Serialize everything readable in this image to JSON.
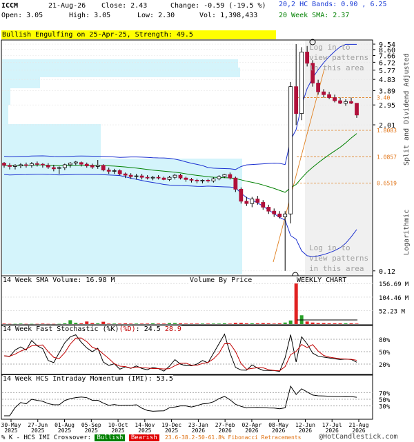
{
  "header": {
    "ticker": "ICCM",
    "date": "21-Aug-26",
    "close": "Close: 2.43",
    "change": "Change: -0.59 (-19.5 %)",
    "open": "Open: 3.05",
    "high": "High: 3.05",
    "low": "Low: 2.30",
    "vol": "Vol: 1,398,433",
    "bands": "20,2 HC Bands: 0.90 , 6.25",
    "sma": "20 Week SMA: 2.37",
    "pattern": "Bullish Engulfing on 25-Apr-25, Strength: 49.5"
  },
  "right_labels": {
    "split": "Split and Dividend Adjusted",
    "log": "Logarithmic"
  },
  "watermark": {
    "text": "Log in to\nview patterns\nin this area"
  },
  "sub_titles": {
    "volume": "14 Week SMA Volume: 16.98 M",
    "vbp": "Volume By Price",
    "weekly": "WEEKLY CHART",
    "stoch_prefix": "14 Week Fast Stochastic (%K)",
    "stoch_d": "(%D)",
    "stoch_k_val": ": 24.5",
    "stoch_d_val": "28.9",
    "imi": "14 Week HCS Intraday Momentum (IMI): 53.5"
  },
  "footer": {
    "legend": "% K - HCS IMI Crossover:",
    "bullish": "Bullish",
    "bearish": "Bearish",
    "fib": "23.6-38.2-50-61.8% Fibonacci Retracements",
    "copyright": "@HotCandlestick.com"
  },
  "chart_data": {
    "type": "candlestick",
    "price_scale": "logarithmic",
    "price_ticks": [
      "9.54",
      "8.60",
      "7.66",
      "6.72",
      "5.77",
      "4.83",
      "3.89",
      "2.95",
      "2.01",
      "0.12"
    ],
    "fib_levels": [
      "3.40",
      "1.8083",
      "1.0857",
      "0.6519"
    ],
    "volume_ticks": [
      "156.69 M",
      "104.46 M",
      "52.23 M"
    ],
    "stoch_ticks": [
      "80%",
      "50%",
      "20%"
    ],
    "imi_ticks": [
      "70%",
      "50%",
      "30%"
    ],
    "x_tick_labels": [
      [
        "30-May",
        "2025"
      ],
      [
        "27-Jun",
        "2025"
      ],
      [
        "01-Aug",
        "2025"
      ],
      [
        "05-Sep",
        "2025"
      ],
      [
        "10-Oct",
        "2025"
      ],
      [
        "14-Nov",
        "2025"
      ],
      [
        "19-Dec",
        "2025"
      ],
      [
        "23-Jan",
        "2026"
      ],
      [
        "27-Feb",
        "2026"
      ],
      [
        "02-Apr",
        "2026"
      ],
      [
        "08-May",
        "2026"
      ],
      [
        "12-Jun",
        "2026"
      ],
      [
        "17-Jul",
        "2026"
      ],
      [
        "21-Aug",
        "2026"
      ]
    ],
    "candles": [
      [
        0.96,
        0.98,
        0.88,
        0.92
      ],
      [
        0.92,
        0.96,
        0.85,
        0.9
      ],
      [
        0.9,
        0.94,
        0.85,
        0.92
      ],
      [
        0.91,
        0.96,
        0.87,
        0.93
      ],
      [
        0.93,
        0.97,
        0.88,
        0.92
      ],
      [
        0.92,
        0.98,
        0.88,
        0.95
      ],
      [
        0.95,
        0.99,
        0.9,
        0.94
      ],
      [
        0.94,
        0.96,
        0.88,
        0.93
      ],
      [
        0.92,
        0.96,
        0.86,
        0.89
      ],
      [
        0.88,
        0.93,
        0.82,
        0.86
      ],
      [
        0.88,
        0.9,
        0.78,
        0.88
      ],
      [
        0.88,
        0.95,
        0.84,
        0.93
      ],
      [
        0.93,
        0.98,
        0.88,
        0.96
      ],
      [
        0.96,
        1.0,
        0.92,
        0.98
      ],
      [
        0.97,
        0.99,
        0.9,
        0.94
      ],
      [
        0.94,
        0.97,
        0.88,
        0.91
      ],
      [
        0.92,
        0.95,
        0.86,
        0.89
      ],
      [
        0.9,
        1.02,
        0.86,
        0.92
      ],
      [
        0.92,
        0.94,
        0.82,
        0.84
      ],
      [
        0.84,
        0.88,
        0.78,
        0.82
      ],
      [
        0.82,
        0.86,
        0.78,
        0.83
      ],
      [
        0.83,
        0.85,
        0.76,
        0.78
      ],
      [
        0.78,
        0.8,
        0.72,
        0.76
      ],
      [
        0.76,
        0.79,
        0.71,
        0.74
      ],
      [
        0.74,
        0.78,
        0.7,
        0.75
      ],
      [
        0.75,
        0.78,
        0.7,
        0.73
      ],
      [
        0.73,
        0.76,
        0.7,
        0.72
      ],
      [
        0.72,
        0.75,
        0.69,
        0.73
      ],
      [
        0.73,
        0.76,
        0.7,
        0.72
      ],
      [
        0.72,
        0.74,
        0.69,
        0.7
      ],
      [
        0.7,
        0.75,
        0.68,
        0.73
      ],
      [
        0.73,
        0.78,
        0.7,
        0.76
      ],
      [
        0.76,
        0.78,
        0.7,
        0.72
      ],
      [
        0.72,
        0.74,
        0.67,
        0.7
      ],
      [
        0.7,
        0.72,
        0.66,
        0.69
      ],
      [
        0.69,
        0.71,
        0.65,
        0.68
      ],
      [
        0.68,
        0.7,
        0.65,
        0.69
      ],
      [
        0.69,
        0.71,
        0.66,
        0.68
      ],
      [
        0.68,
        0.73,
        0.66,
        0.71
      ],
      [
        0.71,
        0.76,
        0.69,
        0.74
      ],
      [
        0.74,
        0.78,
        0.72,
        0.77
      ],
      [
        0.77,
        0.8,
        0.7,
        0.72
      ],
      [
        0.72,
        0.74,
        0.55,
        0.58
      ],
      [
        0.58,
        0.6,
        0.44,
        0.46
      ],
      [
        0.46,
        0.5,
        0.42,
        0.44
      ],
      [
        0.44,
        0.5,
        0.41,
        0.48
      ],
      [
        0.48,
        0.51,
        0.43,
        0.45
      ],
      [
        0.45,
        0.47,
        0.39,
        0.41
      ],
      [
        0.41,
        0.43,
        0.36,
        0.38
      ],
      [
        0.38,
        0.4,
        0.34,
        0.36
      ],
      [
        0.36,
        0.38,
        0.33,
        0.34
      ],
      [
        0.34,
        0.38,
        0.12,
        0.36
      ],
      [
        0.36,
        4.6,
        0.3,
        4.2
      ],
      [
        4.2,
        9.54,
        2.0,
        2.5
      ],
      [
        2.5,
        9.0,
        2.2,
        8.2
      ],
      [
        8.2,
        9.2,
        6.2,
        6.6
      ],
      [
        6.6,
        7.0,
        4.2,
        4.5
      ],
      [
        4.5,
        4.8,
        3.6,
        3.8
      ],
      [
        3.8,
        4.0,
        3.4,
        3.6
      ],
      [
        3.6,
        3.8,
        3.3,
        3.4
      ],
      [
        3.4,
        3.6,
        3.1,
        3.2
      ],
      [
        3.2,
        3.4,
        3.0,
        3.05
      ],
      [
        3.05,
        3.3,
        2.9,
        3.15
      ],
      [
        3.15,
        3.4,
        3.0,
        3.05
      ],
      [
        3.05,
        3.05,
        2.3,
        2.43
      ]
    ],
    "volume_values": [
      2,
      1,
      1,
      2,
      1,
      1,
      1,
      2,
      1,
      1,
      1,
      3,
      15,
      5,
      3,
      10,
      4,
      3,
      9,
      2,
      2,
      2,
      3,
      2,
      2,
      2,
      2,
      3,
      2,
      2,
      4,
      4,
      3,
      2,
      2,
      2,
      2,
      2,
      2,
      2,
      3,
      2,
      5,
      5,
      3,
      3,
      3,
      4,
      3,
      2,
      3,
      6,
      14,
      157,
      34,
      10,
      6,
      4,
      4,
      3,
      3,
      3,
      3,
      3,
      2
    ]
  }
}
